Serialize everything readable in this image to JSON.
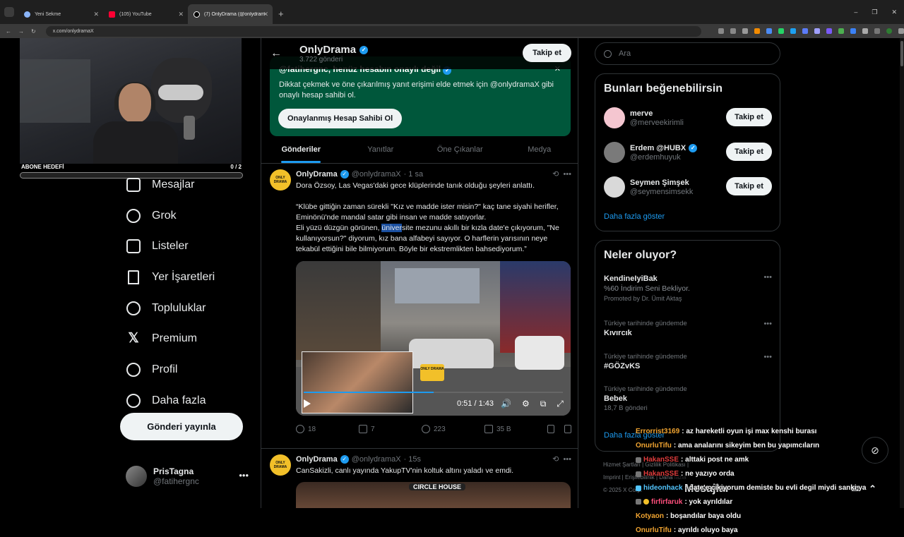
{
  "browser": {
    "tabs": [
      {
        "label": "Yeni Sekme",
        "active": false,
        "color": "#8ab4f8"
      },
      {
        "label": "(105) YouTube",
        "active": false,
        "color": "#ff0033"
      },
      {
        "label": "(7) OnlyDrama (@onlydramaX)",
        "active": true,
        "color": "#ffffff"
      }
    ],
    "url": "x.com/onlydramaX"
  },
  "stream": {
    "goal_label": "ABONE HEDEFİ",
    "goal_value": "0 / 2",
    "goal_progress": 0
  },
  "nav": {
    "items": [
      {
        "label": "Mesajlar",
        "icon": "mail-icon"
      },
      {
        "label": "Grok",
        "icon": "grok-icon"
      },
      {
        "label": "Listeler",
        "icon": "list-icon"
      },
      {
        "label": "Yer İşaretleri",
        "icon": "bookmark-icon"
      },
      {
        "label": "Topluluklar",
        "icon": "people-icon"
      },
      {
        "label": "Premium",
        "icon": "x-logo-icon"
      },
      {
        "label": "Profil",
        "icon": "profile-icon"
      },
      {
        "label": "Daha fazla",
        "icon": "more-circle-icon"
      }
    ],
    "post_button": "Gönderi yayınla",
    "account": {
      "name": "PrisTagna",
      "handle": "@fatihergnc"
    }
  },
  "profile_header": {
    "name": "OnlyDrama",
    "post_count": "3.722 gönderi",
    "follow": "Takip et"
  },
  "promo": {
    "title": "@fatihergnc, henüz hesabın onaylı değil",
    "body": "Dikkat çekmek ve öne çıkarılmış yanıt erişimi elde etmek için @onlydramaX gibi onaylı hesap sahibi ol.",
    "button": "Onaylanmış Hesap Sahibi Ol"
  },
  "tabs": [
    "Gönderiler",
    "Yanıtlar",
    "Öne Çıkanlar",
    "Medya"
  ],
  "tweets": [
    {
      "name": "OnlyDrama",
      "handle": "@onlydramaX",
      "time": "· 1 sa",
      "text_a": "Dora Özsoy, Las Vegas'daki gece klüplerinde tanık olduğu şeyleri anlattı.\n\n“Klübe gittiğin zaman sürekli \"Kız ve madde ister misin?\" kaç tane siyahi herifler, Eminönü'nde mandal satar gibi insan ve madde satıyorlar.\nEli yüzü düzgün görünen, ",
      "text_sel": "üniver",
      "text_b": "site mezunu akıllı bir kızla date'e çıkıyorum, \"Ne kullanıyorsun?\" diyorum, kız bana alfabeyi sayıyor. O harflerin yarısının neye tekabül ettiğini bile bilmiyorum. Böyle bir ekstremlikten bahsediyorum.”",
      "video_time": "0:51 / 1:43",
      "video_progress": 0.5,
      "replies": "18",
      "reposts": "7",
      "likes": "223",
      "views": "35 B"
    },
    {
      "name": "OnlyDrama",
      "handle": "@onlydramaX",
      "time": "· 15s",
      "text": "CanSakizli, canlı yayında YakupTV'nin koltuk altını yaladı ve emdi.",
      "media_caption": "CIRCLE HOUSE"
    }
  ],
  "avatar_text": "ONLY DRAMA",
  "search": {
    "placeholder": "Ara"
  },
  "who_to_follow": {
    "title": "Bunları beğenebilirsin",
    "users": [
      {
        "name": "merve",
        "handle": "@merveekirimli",
        "verified": false,
        "button": "Takip et",
        "color": "#f4c6d0"
      },
      {
        "name": "Erdem @HUBX",
        "handle": "@erdemhuyuk",
        "verified": true,
        "button": "Takip et",
        "color": "#7a7a7a"
      },
      {
        "name": "Seymen Şimşek",
        "handle": "@seymensimsekk",
        "verified": false,
        "button": "Takip et",
        "color": "#d9d9d9"
      }
    ],
    "more": "Daha fazla göster"
  },
  "trends": {
    "title": "Neler oluyor?",
    "items": [
      {
        "category": "",
        "title": "KendineIyiBak",
        "sub": "%60 İndirim Seni Bekliyor.",
        "promoted": "Promoted by Dr. Ümit Aktaş"
      },
      {
        "category": "Türkiye tarihinde gündemde",
        "title": "Kıvırcık",
        "sub": "",
        "promoted": ""
      },
      {
        "category": "Türkiye tarihinde gündemde",
        "title": "#GÖZvKS",
        "sub": "",
        "promoted": ""
      },
      {
        "category": "Türkiye tarihinde gündemde",
        "title": "Bebek",
        "sub": "18,7 B gönderi",
        "promoted": ""
      }
    ],
    "more": "Daha fazla göster"
  },
  "footer": {
    "line1": "Hizmet Şartları | Gizlilik Politikası |",
    "line2": "Imprint | Erişilebilirlik | Daha fazla",
    "line3": "© 2025 X Corp."
  },
  "chat": [
    {
      "user": "Errorrist3169",
      "msg": ": az hareketli oyun işi max kenshi burası",
      "color": "orange"
    },
    {
      "user": "OnurluTifu",
      "msg": ": ama analarını sikeyim ben bu yapımcıların",
      "color": "orange"
    },
    {
      "user": "HakanSSE",
      "msg": ": alttaki post ne amk",
      "color": "red"
    },
    {
      "user": "HakanSSE",
      "msg": ": ne yazıyo orda",
      "color": "red"
    },
    {
      "user": "hideonhack",
      "msg": ": date'e cikiyorum demiste bu evli degil miydi sanki ya",
      "color": "blue"
    },
    {
      "user": "firfirfaruk",
      "msg": ": yok ayrıldılar",
      "color": "pink"
    },
    {
      "user": "Kotyaon",
      "msg": ": boşandılar baya oldu",
      "color": "orange"
    },
    {
      "user": "OnurluTifu",
      "msg": ": ayrıldı oluyo baya",
      "color": "orange"
    }
  ],
  "messages_dock": {
    "label": "Mesajlar"
  }
}
